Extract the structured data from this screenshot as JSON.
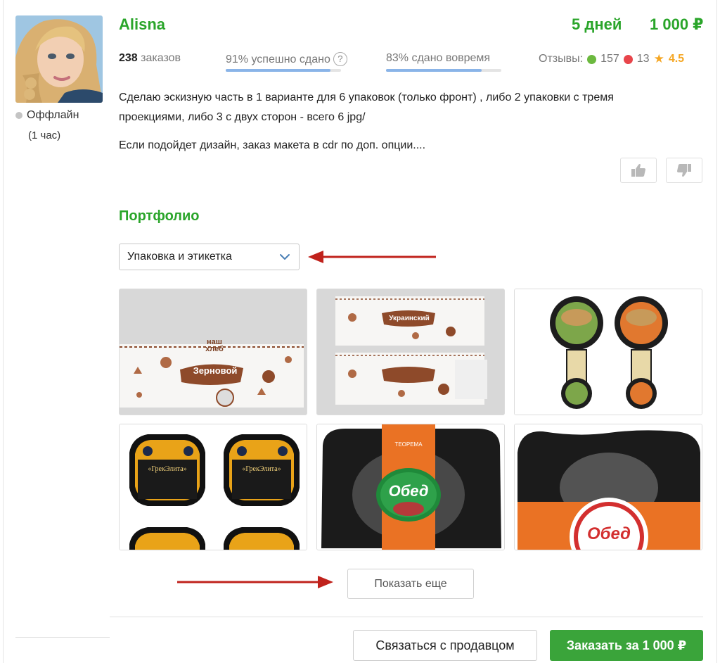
{
  "seller": {
    "name": "Alisna",
    "status": "Оффлайн",
    "status_time": "(1 час)"
  },
  "offer": {
    "deadline": "5 дней",
    "price": "1 000 ₽"
  },
  "stats": {
    "orders_count": "238",
    "orders_label": "заказов",
    "success_label": "91% успешно сдано",
    "success_percent": 91,
    "ontime_label": "83% сдано вовремя",
    "ontime_percent": 83,
    "help_icon": "?"
  },
  "reviews": {
    "label": "Отзывы:",
    "positive": "157",
    "negative": "13",
    "rating": "4.5",
    "positive_color": "#6cb93f",
    "negative_color": "#e8454b",
    "star_color": "#f5a623"
  },
  "description": {
    "paragraph1_line1": "Сделаю эскизную часть в 1 варианте для 6 упаковок (только фронт) , либо 2 упаковки с тремя",
    "paragraph1_line2": "проекциями, либо 3 с двух сторон - всего 6 jpg/",
    "paragraph2": "Если подойдет дизайн, заказ макета в cdr по доп. опции...."
  },
  "portfolio": {
    "title": "Портфолио",
    "category": "Упаковка и этикетка",
    "show_more": "Показать еще",
    "thumb_texts": {
      "brand_bread": "наш хлеб",
      "bread1": "Зерновой",
      "bread2": "Украинский",
      "brand_teorema": "ТЕОРЕМА",
      "olive": "«ГрекЭлита»",
      "lunch": "Обед"
    }
  },
  "actions": {
    "contact": "Связаться с продавцом",
    "order": "Заказать за 1 000 ₽"
  },
  "colors": {
    "accent_green": "#2aa52a",
    "button_green": "#3aa43a",
    "arrow_red": "#c0221c"
  }
}
